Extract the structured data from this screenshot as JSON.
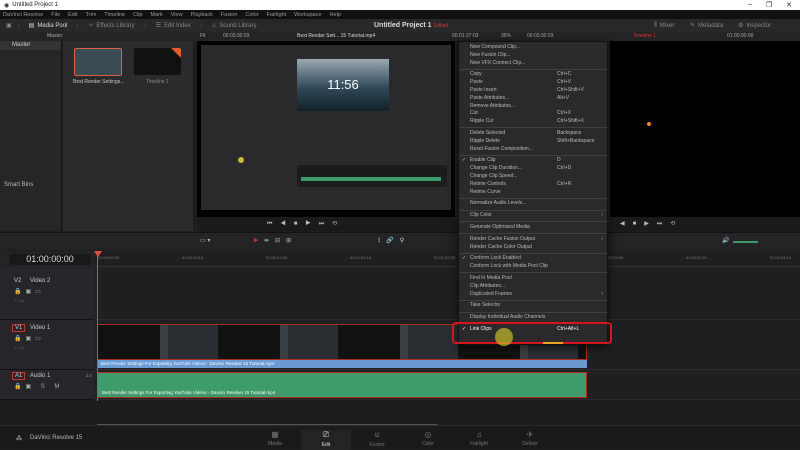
{
  "window": {
    "title": "Untitled Project 1",
    "controls": [
      "–",
      "❐",
      "✕"
    ]
  },
  "menu": [
    "DaVinci Resolve",
    "File",
    "Edit",
    "Trim",
    "Timeline",
    "Clip",
    "Mark",
    "View",
    "Playback",
    "Fusion",
    "Color",
    "Fairlight",
    "Workspace",
    "Help"
  ],
  "toolbar": {
    "media_pool": "Media Pool",
    "effects_library": "Effects Library",
    "edit_index": "Edit Index",
    "sound_library": "Sound Library",
    "project_title": "Untitled Project 1",
    "project_status": "Edited",
    "mixer": "Mixer",
    "metadata": "Metadata",
    "inspector": "Inspector"
  },
  "subbar": {
    "bin": "Master",
    "fit": "Fit",
    "src_duration": "00:03:30:03",
    "src_clip": "Best Render Sett... 15 Tutorial.mp4",
    "src_tc": "00:01:37:03",
    "zoom": "36%",
    "tl_duration": "00:03:30:03",
    "timeline_name": "Timeline 1",
    "prog_tc": "01:00:00:00"
  },
  "bins": {
    "master": "Master",
    "smart_bins": "Smart Bins"
  },
  "pool": {
    "clips": [
      {
        "name": "Best Render Settings..."
      },
      {
        "name": "Timeline 1"
      }
    ]
  },
  "source_preview_clock": "11:56",
  "timeline": {
    "timecode": "01:00:00:00",
    "ruler": [
      "01:00:00:00",
      "01:00:20:13",
      "01:00:41:02",
      "01:01:01:16",
      "01:01:22:05",
      "01:01:42:19",
      "01:02:03:08",
      "01:02:23:21",
      "01:02:44:10"
    ],
    "tracks": [
      {
        "id": "V2",
        "name": "Video 2",
        "sub": "0 Clip"
      },
      {
        "id": "V1",
        "name": "Video 1",
        "sub": "1 Clip"
      },
      {
        "id": "A1",
        "name": "Audio 1",
        "level": "2.0"
      }
    ],
    "clip_name": "Best Render Settings For Exporting YouTube Videos - Davinci Resolve 15 Tutorial.mp4"
  },
  "context_menu": [
    {
      "label": "New Compound Clip..."
    },
    {
      "label": "New Fusion Clip..."
    },
    {
      "label": "New VFX Connect Clip..."
    },
    {
      "sep": true
    },
    {
      "label": "Copy",
      "shortcut": "Ctrl+C"
    },
    {
      "label": "Paste",
      "shortcut": "Ctrl+V"
    },
    {
      "label": "Paste Insert",
      "shortcut": "Ctrl+Shift+V"
    },
    {
      "label": "Paste Attributes...",
      "shortcut": "Alt+V"
    },
    {
      "label": "Remove Attributes..."
    },
    {
      "label": "Cut",
      "shortcut": "Ctrl+X"
    },
    {
      "label": "Ripple Cut",
      "shortcut": "Ctrl+Shift+X"
    },
    {
      "sep": true
    },
    {
      "label": "Delete Selected",
      "shortcut": "Backspace"
    },
    {
      "label": "Ripple Delete",
      "shortcut": "Shift+Backspace"
    },
    {
      "label": "Reset Fusion Composition..."
    },
    {
      "sep": true
    },
    {
      "label": "Enable Clip",
      "shortcut": "D",
      "checked": "✓"
    },
    {
      "label": "Change Clip Duration...",
      "shortcut": "Ctrl+D"
    },
    {
      "label": "Change Clip Speed..."
    },
    {
      "label": "Retime Controls",
      "shortcut": "Ctrl+R"
    },
    {
      "label": "Retime Curve"
    },
    {
      "sep": true
    },
    {
      "label": "Normalize Audio Levels..."
    },
    {
      "sep": true
    },
    {
      "label": "Clip Color",
      "arrow": "›"
    },
    {
      "sep": true
    },
    {
      "label": "Generate Optimized Media"
    },
    {
      "sep": true
    },
    {
      "label": "Render Cache Fusion Output",
      "arrow": "›"
    },
    {
      "label": "Render Cache Color Output"
    },
    {
      "sep": true
    },
    {
      "label": "Conform Lock Enabled",
      "checked": "✓"
    },
    {
      "label": "Conform Lock with Media Pool Clip"
    },
    {
      "sep": true
    },
    {
      "label": "Find In Media Pool"
    },
    {
      "label": "Clip Attributes..."
    },
    {
      "label": "Duplicated Frames",
      "arrow": "›"
    },
    {
      "sep": true
    },
    {
      "label": "Take Selector"
    },
    {
      "sep": true
    },
    {
      "label": "Display Individual Audio Channels"
    },
    {
      "sep": true
    },
    {
      "label": "Link Clips",
      "shortcut": "Ctrl+Alt+L",
      "checked": "✓"
    }
  ],
  "pages": {
    "app": "DaVinci Resolve 15",
    "items": [
      "Media",
      "Edit",
      "Fusion",
      "Color",
      "Fairlight",
      "Deliver"
    ],
    "active": "Edit"
  },
  "colors": {
    "accent": "#e64b3c",
    "video_clip": "#6c9ad3",
    "audio_clip": "#3e9b6a",
    "highlight": "#d4161d"
  }
}
